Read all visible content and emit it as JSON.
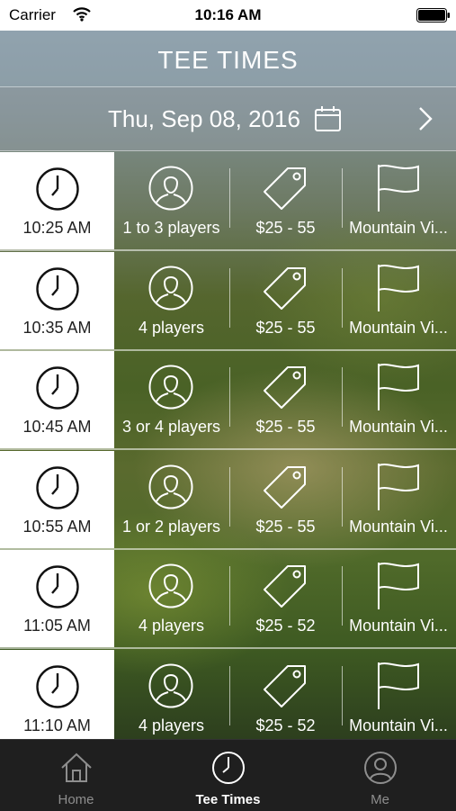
{
  "status_bar": {
    "carrier": "Carrier",
    "time": "10:16 AM"
  },
  "header": {
    "title": "TEE TIMES"
  },
  "date_bar": {
    "date": "Thu, Sep 08, 2016",
    "calendar_icon": "calendar-icon",
    "next_icon": "chevron-right-icon"
  },
  "tee_times": [
    {
      "time": "10:25 AM",
      "players": "1 to 3 players",
      "price": "$25 - 55",
      "course": "Mountain Vi..."
    },
    {
      "time": "10:35 AM",
      "players": "4 players",
      "price": "$25 - 55",
      "course": "Mountain Vi..."
    },
    {
      "time": "10:45 AM",
      "players": "3 or 4 players",
      "price": "$25 - 55",
      "course": "Mountain Vi..."
    },
    {
      "time": "10:55 AM",
      "players": "1 or 2 players",
      "price": "$25 - 55",
      "course": "Mountain Vi..."
    },
    {
      "time": "11:05 AM",
      "players": "4 players",
      "price": "$25 - 52",
      "course": "Mountain Vi..."
    },
    {
      "time": "11:10 AM",
      "players": "4 players",
      "price": "$25 - 52",
      "course": "Mountain Vi..."
    }
  ],
  "tab_bar": {
    "tabs": [
      {
        "label": "Home",
        "icon": "home-icon",
        "active": false
      },
      {
        "label": "Tee Times",
        "icon": "clock-icon",
        "active": true
      },
      {
        "label": "Me",
        "icon": "person-icon",
        "active": false
      }
    ]
  },
  "colors": {
    "tab_bar_bg": "#1f1f1f",
    "tab_active": "#ffffff",
    "tab_inactive": "#8e8e8e"
  }
}
